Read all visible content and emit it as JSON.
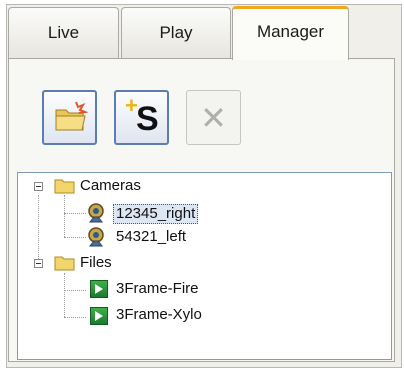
{
  "tabs": [
    {
      "label": "Live"
    },
    {
      "label": "Play"
    },
    {
      "label": "Manager",
      "active": true
    }
  ],
  "toolbar": {
    "open_icon": "folder-open-icon",
    "add_icon": "add-server-icon",
    "add_glyph": "S",
    "delete_icon": "close-icon",
    "delete_enabled": false
  },
  "tree": {
    "cameras": {
      "label": "Cameras",
      "items": [
        {
          "label": "12345_right",
          "selected": true,
          "icon": "camera-icon"
        },
        {
          "label": "54321_left",
          "icon": "camera-icon"
        }
      ]
    },
    "files": {
      "label": "Files",
      "items": [
        {
          "label": "3Frame-Fire",
          "icon": "file-arrow-icon"
        },
        {
          "label": "3Frame-Xylo",
          "icon": "file-arrow-icon"
        }
      ]
    }
  },
  "colors": {
    "active_tab_accent": "#f0a81e",
    "button_border": "#5b7db3",
    "tree_border": "#7f9db9",
    "file_icon": "#2a9a3a"
  }
}
